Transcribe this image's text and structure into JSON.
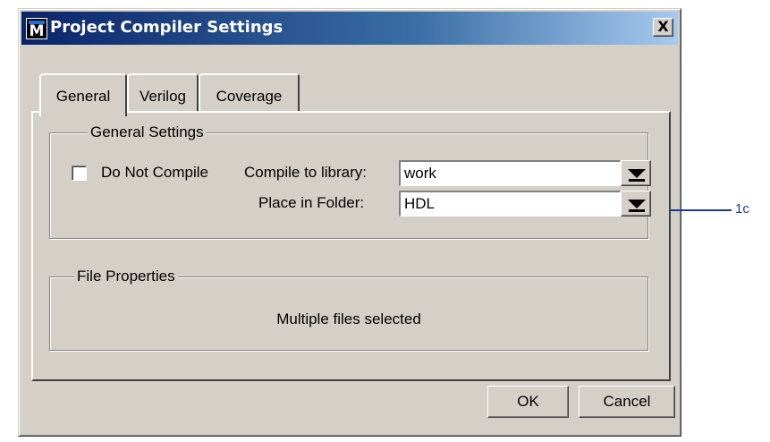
{
  "window": {
    "icon_letter": "M",
    "title": "Project Compiler Settings",
    "close_label": "X"
  },
  "tabs": [
    {
      "label": "General",
      "active": true
    },
    {
      "label": "Verilog",
      "active": false
    },
    {
      "label": "Coverage",
      "active": false
    }
  ],
  "general_settings": {
    "group_title": "General Settings",
    "do_not_compile": {
      "label": "Do Not Compile",
      "checked": false
    },
    "compile_to_library": {
      "label": "Compile to library:",
      "value": "work"
    },
    "place_in_folder": {
      "label": "Place in Folder:",
      "value": "HDL"
    }
  },
  "file_properties": {
    "group_title": "File Properties",
    "message": "Multiple files selected"
  },
  "buttons": {
    "ok": "OK",
    "cancel": "Cancel"
  },
  "annotation": {
    "label": "1c",
    "color": "#1c3a9e"
  }
}
